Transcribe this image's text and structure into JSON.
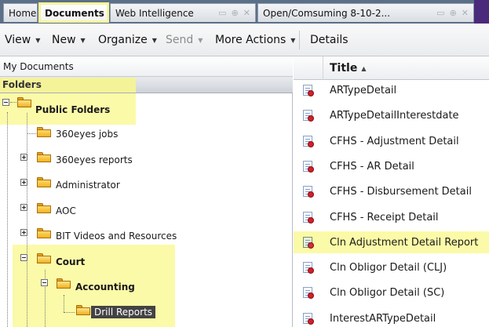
{
  "tabs": [
    {
      "label": "Home",
      "active": false
    },
    {
      "label": "Documents",
      "active": true
    },
    {
      "label": "Web Intelligence",
      "active": false
    },
    {
      "label": "Open/Comsuming 8-10-2...",
      "active": false
    }
  ],
  "toolbar": {
    "view": "View",
    "new": "New",
    "organize": "Organize",
    "send": "Send",
    "more_actions": "More Actions",
    "details": "Details"
  },
  "left": {
    "my_documents": "My Documents",
    "folders_header": "Folders",
    "tree": {
      "public_folders": "Public Folders",
      "n_360eyes_jobs": "360eyes jobs",
      "n_360eyes_reports": "360eyes reports",
      "administrator": "Administrator",
      "aoc": "AOC",
      "bit_videos": "BIT Videos and Resources",
      "court": "Court",
      "accounting": "Accounting",
      "drill_reports": "Drill Reports"
    }
  },
  "right": {
    "column_title": "Title",
    "documents": [
      "ARTypeDetail",
      "ARTypeDetailInterestdate",
      "CFHS - Adjustment Detail",
      "CFHS - AR Detail",
      "CFHS - Disbursement Detail",
      "CFHS - Receipt Detail",
      "Cln Adjustment Detail Report",
      "Cln Obligor Detail (CLJ)",
      "Cln Obligor Detail (SC)",
      "InterestARTypeDetail"
    ]
  },
  "colors": {
    "highlight": "#fbfaa8",
    "tabbar": "#5b6f87",
    "selected_node": "#434343"
  }
}
